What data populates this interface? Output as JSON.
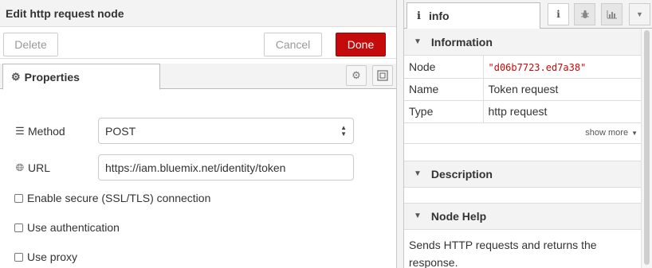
{
  "tray": {
    "title": "Edit http request node",
    "delete_label": "Delete",
    "cancel_label": "Cancel",
    "done_label": "Done",
    "tab_properties": "Properties",
    "method_label": "Method",
    "method_value": "POST",
    "url_label": "URL",
    "url_value": "https://iam.bluemix.net/identity/token",
    "ssl_label": "Enable secure (SSL/TLS) connection",
    "auth_label": "Use authentication",
    "proxy_label": "Use proxy"
  },
  "sidebar": {
    "tab_label": "info",
    "info_section": "Information",
    "rows": [
      {
        "key": "Node",
        "value": "\"d06b7723.ed7a38\""
      },
      {
        "key": "Name",
        "value": "Token request"
      },
      {
        "key": "Type",
        "value": "http request"
      }
    ],
    "show_more": "show more",
    "description_section": "Description",
    "help_section": "Node Help",
    "help_text": "Sends HTTP requests and returns the response."
  },
  "colors": {
    "done_bg": "#c40a0a",
    "node_id": "#c40a0a",
    "header_bg": "#f3f3f3"
  },
  "icons": {
    "properties_tab": "gear-icon",
    "method": "list-icon",
    "url": "globe-icon",
    "sidebar_info": "info-icon",
    "sidebar_debug": "bug-icon",
    "sidebar_chart": "bar-chart-icon",
    "section_toggle": "chevron-down-icon"
  }
}
